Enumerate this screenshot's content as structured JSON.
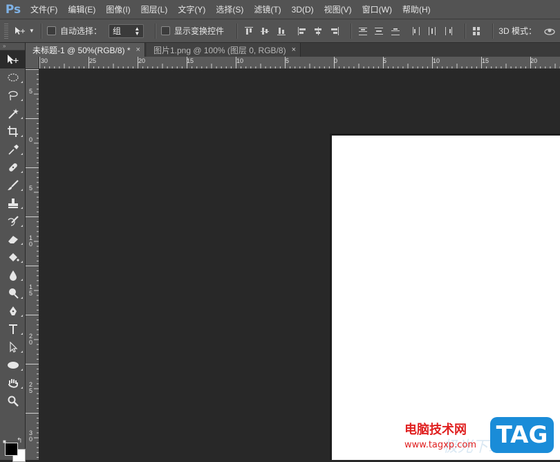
{
  "app": {
    "logo": "Ps",
    "menu": [
      "文件(F)",
      "编辑(E)",
      "图像(I)",
      "图层(L)",
      "文字(Y)",
      "选择(S)",
      "滤镜(T)",
      "3D(D)",
      "视图(V)",
      "窗口(W)",
      "帮助(H)"
    ]
  },
  "options": {
    "tool_preset_icon": "move-tool-icon",
    "auto_select_label": "自动选择：",
    "auto_select_checked": false,
    "auto_select_value": "组",
    "show_transform_label": "显示变换控件",
    "show_transform_checked": false,
    "mode_label": "3D 模式："
  },
  "tabs": [
    {
      "title": "未标题-1 @ 50%(RGB/8) *",
      "active": true,
      "close": "×"
    },
    {
      "title": "图片1.png @ 100% (图层 0, RGB/8)",
      "active": false,
      "close": "×"
    }
  ],
  "ruler_h": [
    "30",
    "25",
    "20",
    "15",
    "10",
    "5",
    "0",
    "5",
    "10",
    "15",
    "20"
  ],
  "ruler_v": [
    "5",
    "0",
    "5",
    "1 0",
    "1 5",
    "2 0",
    "2 5",
    "3 0"
  ],
  "tools": [
    "move-tool-icon",
    "marquee-tool-icon",
    "lasso-tool-icon",
    "magic-wand-tool-icon",
    "crop-tool-icon",
    "eyedropper-tool-icon",
    "healing-brush-tool-icon",
    "brush-tool-icon",
    "clone-stamp-tool-icon",
    "history-brush-tool-icon",
    "eraser-tool-icon",
    "paint-bucket-tool-icon",
    "blur-tool-icon",
    "dodge-tool-icon",
    "pen-tool-icon",
    "type-tool-icon",
    "path-selection-tool-icon",
    "ellipse-tool-icon",
    "hand-tool-icon",
    "zoom-tool-icon"
  ],
  "colors": {
    "foreground": "#000000",
    "background": "#ffffff"
  },
  "watermark": {
    "site_name": "电脑技术网",
    "url": "www.tagxp.com",
    "badge": "TAG",
    "faint": "极光下载站",
    "badge_color": "#1a8cd8",
    "text_color": "#e02020"
  }
}
